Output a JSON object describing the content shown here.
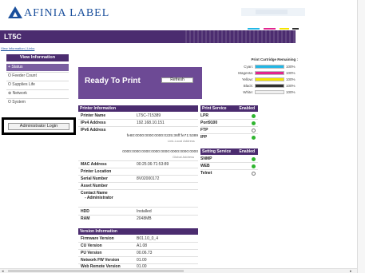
{
  "brand": {
    "name": "AFINIA LABEL",
    "icon": "afinia-triangle-logo",
    "accent_colors": [
      "#22b7e6",
      "#e2258e",
      "#f5e400",
      "#2f2f2f"
    ]
  },
  "page": {
    "title": "LT5C"
  },
  "breadcrumb": "View Information | Links",
  "sidebar": {
    "header": "View Information",
    "items": [
      {
        "label": "Status",
        "active": true,
        "icon": "plus-icon",
        "prefix": "+"
      },
      {
        "label": "Feeder Count",
        "active": false,
        "icon": "radio-icon",
        "prefix": "O"
      },
      {
        "label": "Supplies Life",
        "active": false,
        "icon": "radio-icon",
        "prefix": "O"
      },
      {
        "label": "Network",
        "active": false,
        "icon": "radio-icon",
        "prefix": "⊕"
      },
      {
        "label": "System",
        "active": false,
        "icon": "radio-icon",
        "prefix": "O"
      }
    ],
    "admin_button": "Administrator Login"
  },
  "status": {
    "text": "Ready To Print",
    "refresh_label": "Refresh"
  },
  "cartridge": {
    "title": "Print Cartridge Remaining :",
    "items": [
      {
        "label": "Cyan:",
        "color": "#22b7e6",
        "percent": "100%",
        "level": 1.0
      },
      {
        "label": "Magenta:",
        "color": "#e2258e",
        "percent": "100%",
        "level": 1.0
      },
      {
        "label": "Yellow:",
        "color": "#f5e400",
        "percent": "100%",
        "level": 1.0
      },
      {
        "label": "Black:",
        "color": "#2f2f2f",
        "percent": "100%",
        "level": 1.0
      },
      {
        "label": "White:",
        "color": "#f0f0f0",
        "percent": "100%",
        "level": 1.0
      }
    ]
  },
  "printer_info": {
    "header": "Printer Information",
    "rows": [
      {
        "label": "Printer Name",
        "value": "LT5C-715389"
      },
      {
        "label": "IPv4 Address",
        "value": "192.168.10.151"
      },
      {
        "label": "IPv6 Address",
        "value": ""
      }
    ],
    "ipv6_link_local": "fe80:0000:0000:0000:0225:36ff:fe71:5389",
    "ipv6_link_local_caption": "Link-Local Address",
    "ipv6_global": "0000:0000:0000:0000:0000:0000:0000:0000",
    "ipv6_global_caption": "Global Address",
    "rows2": [
      {
        "label": "MAC Address",
        "value": "00:25:36:71:53:89"
      },
      {
        "label": "Printer Location",
        "value": ""
      },
      {
        "label": "Serial Number",
        "value": "8V02000172"
      },
      {
        "label": "Asset Number",
        "value": ""
      },
      {
        "label": "Contact Name",
        "value": ""
      },
      {
        "label": "- Administrator",
        "value": ""
      }
    ],
    "rows3": [
      {
        "label": "HDD",
        "value": "Installed"
      },
      {
        "label": "RAM",
        "value": "2048MB"
      }
    ]
  },
  "version_info": {
    "header": "Version Information",
    "rows": [
      {
        "label": "Firmware Version",
        "value": "B01.10_0_4"
      },
      {
        "label": "CU Version",
        "value": "A1.08"
      },
      {
        "label": "PU Version",
        "value": "00.06.73"
      },
      {
        "label": "Network FW Version",
        "value": "01.00"
      },
      {
        "label": "Web Remote Version",
        "value": "01.00"
      }
    ]
  },
  "print_service": {
    "header": "Print Service",
    "header_right": "Enabled",
    "rows": [
      {
        "label": "LPR",
        "enabled": true
      },
      {
        "label": "Port9100",
        "enabled": true
      },
      {
        "label": "FTP",
        "enabled": false
      },
      {
        "label": "IPP",
        "enabled": true
      }
    ]
  },
  "setting_service": {
    "header": "Setting Service",
    "header_right": "Enabled",
    "rows": [
      {
        "label": "SNMP",
        "enabled": true
      },
      {
        "label": "WEB",
        "enabled": true
      },
      {
        "label": "Telnet",
        "enabled": false
      }
    ]
  },
  "colors": {
    "primary": "#4b2c6f",
    "status_bar": "#6d4a95",
    "enabled": "#2fb52f",
    "highlight_box": "#000000"
  }
}
